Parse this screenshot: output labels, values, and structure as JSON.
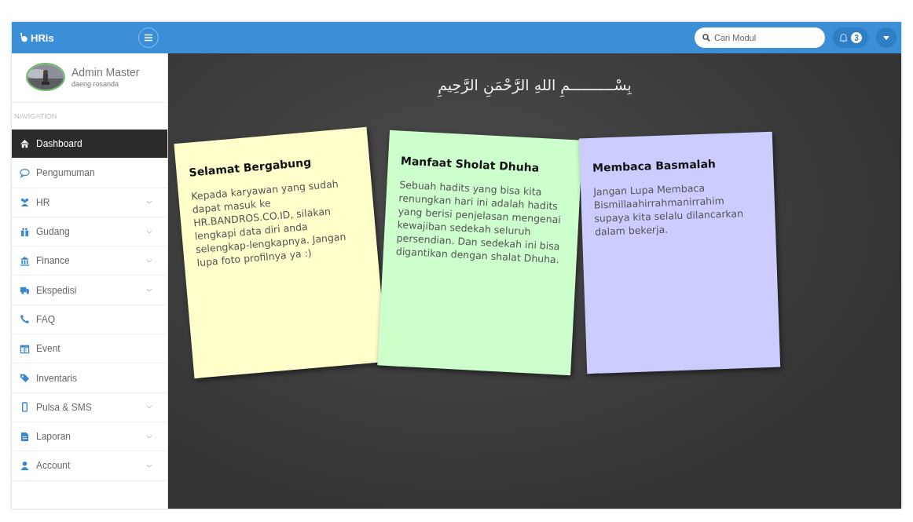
{
  "header": {
    "logo": "HRis",
    "search": {
      "placeholder": "Cari Modul"
    },
    "notifications": {
      "count": "3"
    }
  },
  "sidebar": {
    "user": {
      "name": "Admin Master",
      "subtitle": "daeng rosanda"
    },
    "section_label": "NAVIGATION",
    "items": [
      {
        "label": "Dashboard",
        "selected": true,
        "expandable": false
      },
      {
        "label": "Pengumuman",
        "selected": false,
        "expandable": false
      },
      {
        "label": "HR",
        "selected": false,
        "expandable": true
      },
      {
        "label": "Gudang",
        "selected": false,
        "expandable": true
      },
      {
        "label": "Finance",
        "selected": false,
        "expandable": true
      },
      {
        "label": "Ekspedisi",
        "selected": false,
        "expandable": true
      },
      {
        "label": "FAQ",
        "selected": false,
        "expandable": false
      },
      {
        "label": "Event",
        "selected": false,
        "expandable": false
      },
      {
        "label": "Inventaris",
        "selected": false,
        "expandable": false
      },
      {
        "label": "Pulsa & SMS",
        "selected": false,
        "expandable": true
      },
      {
        "label": "Laporan",
        "selected": false,
        "expandable": true
      },
      {
        "label": "Account",
        "selected": false,
        "expandable": true
      }
    ]
  },
  "main": {
    "heading": "بِسْــــــــــمِ اللهِ الرَّحْمَنِ الرَّحِيمِ",
    "notes": [
      {
        "title": "Selamat Bergabung",
        "body": "Kepada karyawan yang sudah dapat masuk ke HR.BANDROS.CO.ID, silakan lengkapi data diri anda selengkap-lengkapnya. Jangan lupa foto profilnya ya :)",
        "color": "#ffffcc"
      },
      {
        "title": "Manfaat Sholat Dhuha",
        "body": "Sebuah hadits yang bisa kita renungkan hari ini adalah hadits yang berisi penjelasan mengenai kewajiban sedekah seluruh persendian. Dan sedekah ini bisa digantikan dengan shalat Dhuha.",
        "color": "#ccffcc"
      },
      {
        "title": "Membaca Basmalah",
        "body": "Jangan Lupa Membaca Bismillaahirrahmanirrahim supaya kita selalu dilancarkan dalam bekerja.",
        "color": "#ccccff"
      }
    ]
  }
}
